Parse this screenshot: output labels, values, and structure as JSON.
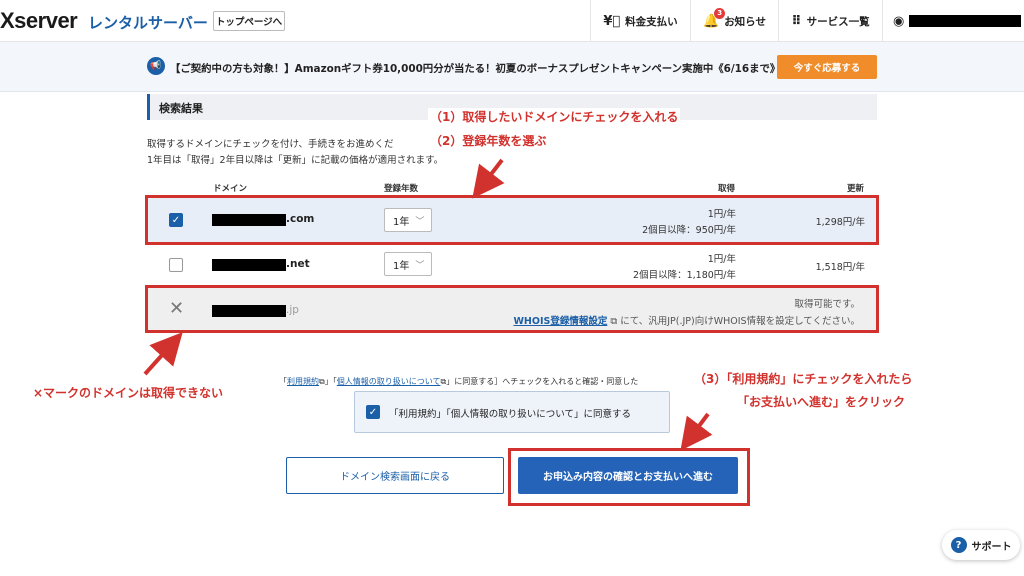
{
  "header": {
    "logo": "Xserver",
    "logo_sub": "レンタルサーバー",
    "top_link": "トップページへ",
    "payment": "料金支払い",
    "notices": "お知らせ",
    "notice_count": "3",
    "services": "サービス一覧"
  },
  "banner": {
    "text": "【ご契約中の方も対象！】Amazonギフト券10,000円分が当たる！初夏のボーナスプレゼントキャンペーン実施中《6/16まで》",
    "button": "今すぐ応募する"
  },
  "section": {
    "title": "検索結果",
    "desc1": "取得するドメインにチェックを付け、手続きをお進めくだ",
    "desc2": "1年目は「取得」2年目以降は「更新」に記載の価格が適用されます。"
  },
  "table": {
    "headers": {
      "domain": "ドメイン",
      "years": "登録年数",
      "acquire": "取得",
      "renew": "更新"
    },
    "rows": [
      {
        "tld": ".com",
        "years": "1年",
        "price1": "1円/年",
        "price2": "2個目以降：950円/年",
        "renew": "1,298円/年",
        "checked": true
      },
      {
        "tld": ".net",
        "years": "1年",
        "price1": "1円/年",
        "price2": "2個目以降：1,180円/年",
        "renew": "1,518円/年",
        "checked": false
      },
      {
        "tld": ".jp",
        "status": "取得可能です。",
        "whois_link": "WHOIS登録情報設定",
        "whois_rest": "にて、汎用JP(.JP)向けWHOIS情報を設定してください。"
      }
    ]
  },
  "annotations": {
    "step1": "（1）取得したいドメインにチェックを入れる",
    "step2": "（2）登録年数を選ぶ",
    "unavailable": "×マークのドメインは取得できない",
    "step3a": "（3）「利用規約」にチェックを入れたら",
    "step3b": "「お支払いへ進む」をクリック"
  },
  "agreement": {
    "note_pre": "「",
    "terms_link": "利用規約",
    "note_mid": "」「",
    "privacy_link": "個人情報の取り扱いについて",
    "note_post": "」に同意する］へチェックを入れると確認・同意した",
    "label": "「利用規約」「個人情報の取り扱いについて」に同意する"
  },
  "buttons": {
    "back": "ドメイン検索画面に戻る",
    "proceed": "お申込み内容の確認とお支払いへ進む"
  },
  "support": {
    "label": "サポート"
  },
  "colors": {
    "brand_blue": "#1b5fa8",
    "annotation_red": "#d2322d",
    "banner_orange": "#f08c2a"
  }
}
